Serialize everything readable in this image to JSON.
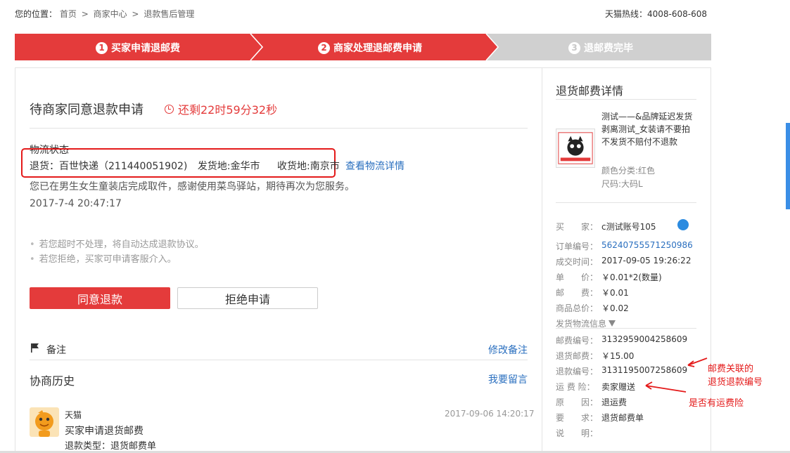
{
  "header": {
    "location_label": "您的位置：",
    "crumbs": [
      "首页",
      "商家中心",
      "退款售后管理"
    ],
    "separator": ">",
    "hotline": "天猫热线：4008-608-608"
  },
  "steps": [
    {
      "num": "1",
      "label": "买家申请退邮费",
      "state": "done"
    },
    {
      "num": "2",
      "label": "商家处理退邮费申请",
      "state": "active"
    },
    {
      "num": "3",
      "label": "退邮费完毕",
      "state": "pending"
    }
  ],
  "colors": {
    "accent": "#e43b3b",
    "step_pending": "#d0d0d0",
    "link": "#2a6fbf",
    "annotation": "#e41a1a"
  },
  "main": {
    "status_title": "待商家同意退款申请",
    "countdown": "还剩22时59分32秒",
    "logistics": {
      "title": "物流状态",
      "carrier": "退货：百世快递（211440051902)",
      "origin": "发货地:金华市",
      "destination": "收货地:南京市",
      "detail_link": "查看物流详情",
      "pickup_message": "您已在男生女生童装店完成取件，感谢使用菜鸟驿站，期待再次为您服务。",
      "time": "2017-7-4 20:47:17"
    },
    "tips": [
      "若您超时不处理，将自动达成退款协议。",
      "若您拒绝，买家可申请客服介入。"
    ],
    "agree_button": "同意退款",
    "reject_button": "拒绝申请",
    "note_label": "备注",
    "note_link": "修改备注",
    "history_title": "协商历史",
    "message_link": "我要留言",
    "history": {
      "author": "天猫",
      "time": "2017-09-06 14:20:17",
      "text": "买家申请退货邮费",
      "type": "退款类型：退货邮费单"
    }
  },
  "detail": {
    "title": "退货邮费详情",
    "product": {
      "name": "测试——&品牌延迟发货剥离测试_女装请不要拍不发货不赔付不退款",
      "color": "颜色分类:红色",
      "size": "尺码:大码L"
    },
    "rows_top": [
      {
        "k": "买　　家：",
        "v": "c测试账号105"
      },
      {
        "k": "订单编号：",
        "v": "56240755571250986",
        "link": true
      },
      {
        "k": "成交时间：",
        "v": "2017-09-05 19:26:22"
      },
      {
        "k": "单　　价：",
        "v": "￥0.01*2(数量)"
      },
      {
        "k": "邮　　费：",
        "v": "￥0.01"
      },
      {
        "k": "商品总价：",
        "v": "￥0.02"
      }
    ],
    "ship_info": "发货物流信息",
    "rows_bottom": [
      {
        "k": "邮费编号：",
        "v": "3132959004258609"
      },
      {
        "k": "退货邮费：",
        "v": "￥15.00"
      },
      {
        "k": "退款编号：",
        "v": "3131195007258609"
      },
      {
        "k": "运 费 险：",
        "v": "卖家赠送"
      },
      {
        "k": "原　　因：",
        "v": "退运费"
      },
      {
        "k": "要　　求：",
        "v": "退货邮费单"
      },
      {
        "k": "说　　明：",
        "v": ""
      }
    ]
  },
  "annotations": {
    "line1": "邮费关联的",
    "line2": "退货退款编号",
    "line3": "是否有运费险"
  }
}
